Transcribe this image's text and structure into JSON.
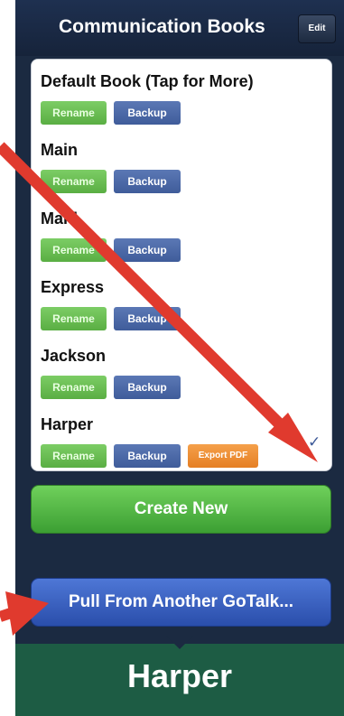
{
  "header": {
    "title": "Communication Books",
    "edit_label": "Edit"
  },
  "books": [
    {
      "name": "Default Book (Tap for More)",
      "rename_label": "Rename",
      "backup_label": "Backup"
    },
    {
      "name": "Main",
      "rename_label": "Rename",
      "backup_label": "Backup"
    },
    {
      "name": "Maid",
      "rename_label": "Rename",
      "backup_label": "Backup"
    },
    {
      "name": "Express",
      "rename_label": "Rename",
      "backup_label": "Backup"
    },
    {
      "name": "Jackson",
      "rename_label": "Rename",
      "backup_label": "Backup"
    },
    {
      "name": "Harper",
      "rename_label": "Rename",
      "backup_label": "Backup",
      "export_label": "Export PDF",
      "selected_mark": "✓"
    }
  ],
  "actions": {
    "create_label": "Create New",
    "pull_label": "Pull From Another GoTalk..."
  },
  "footer": {
    "title": "Harper"
  },
  "colors": {
    "rename": "#6cc257",
    "backup": "#4a68a8",
    "export": "#ee8f35",
    "arrow": "#e03a2e"
  }
}
